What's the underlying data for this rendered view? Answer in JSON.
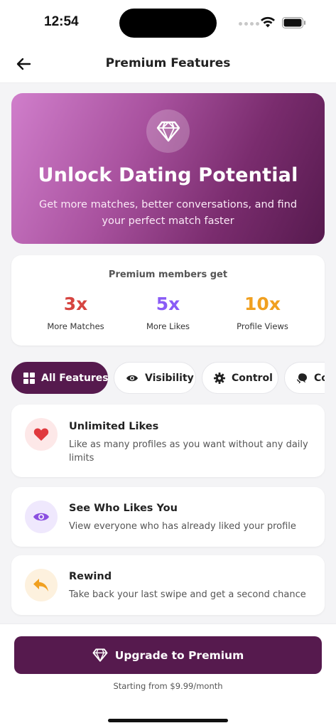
{
  "status_bar": {
    "time": "12:54"
  },
  "header": {
    "title": "Premium Features"
  },
  "hero": {
    "title": "Unlock Dating Potential",
    "subtitle": "Get more matches, better conversations, and find your perfect match faster",
    "icon": "diamond-icon"
  },
  "stats": {
    "heading": "Premium members get",
    "items": [
      {
        "value": "3x",
        "label": "More Matches",
        "color": "#d64541"
      },
      {
        "value": "5x",
        "label": "More Likes",
        "color": "#8a5cf6"
      },
      {
        "value": "10x",
        "label": "Profile Views",
        "color": "#f0a020"
      }
    ]
  },
  "tabs": [
    {
      "label": "All Features",
      "icon": "grid-icon",
      "active": true
    },
    {
      "label": "Visibility",
      "icon": "eye-icon",
      "active": false
    },
    {
      "label": "Control",
      "icon": "gear-icon",
      "active": false
    },
    {
      "label": "Co",
      "icon": "chat-icon",
      "active": false
    }
  ],
  "features": [
    {
      "title": "Unlimited Likes",
      "description": "Like as many profiles as you want without any daily limits",
      "icon": "heart-icon",
      "icon_color": "#e0393e",
      "icon_bg": "#fde8e8"
    },
    {
      "title": "See Who Likes You",
      "description": "View everyone who has already liked your profile",
      "icon": "eye-icon",
      "icon_color": "#8a4fe0",
      "icon_bg": "#efe8fd"
    },
    {
      "title": "Rewind",
      "description": "Take back your last swipe and get a second chance",
      "icon": "rewind-icon",
      "icon_color": "#f0a020",
      "icon_bg": "#fdf1de"
    }
  ],
  "cta": {
    "label": "Upgrade to Premium",
    "pricing": "Starting from $9.99/month"
  },
  "colors": {
    "brand": "#561a4e",
    "hero_gradient_start": "#d07ecb",
    "hero_gradient_end": "#561a4e"
  }
}
